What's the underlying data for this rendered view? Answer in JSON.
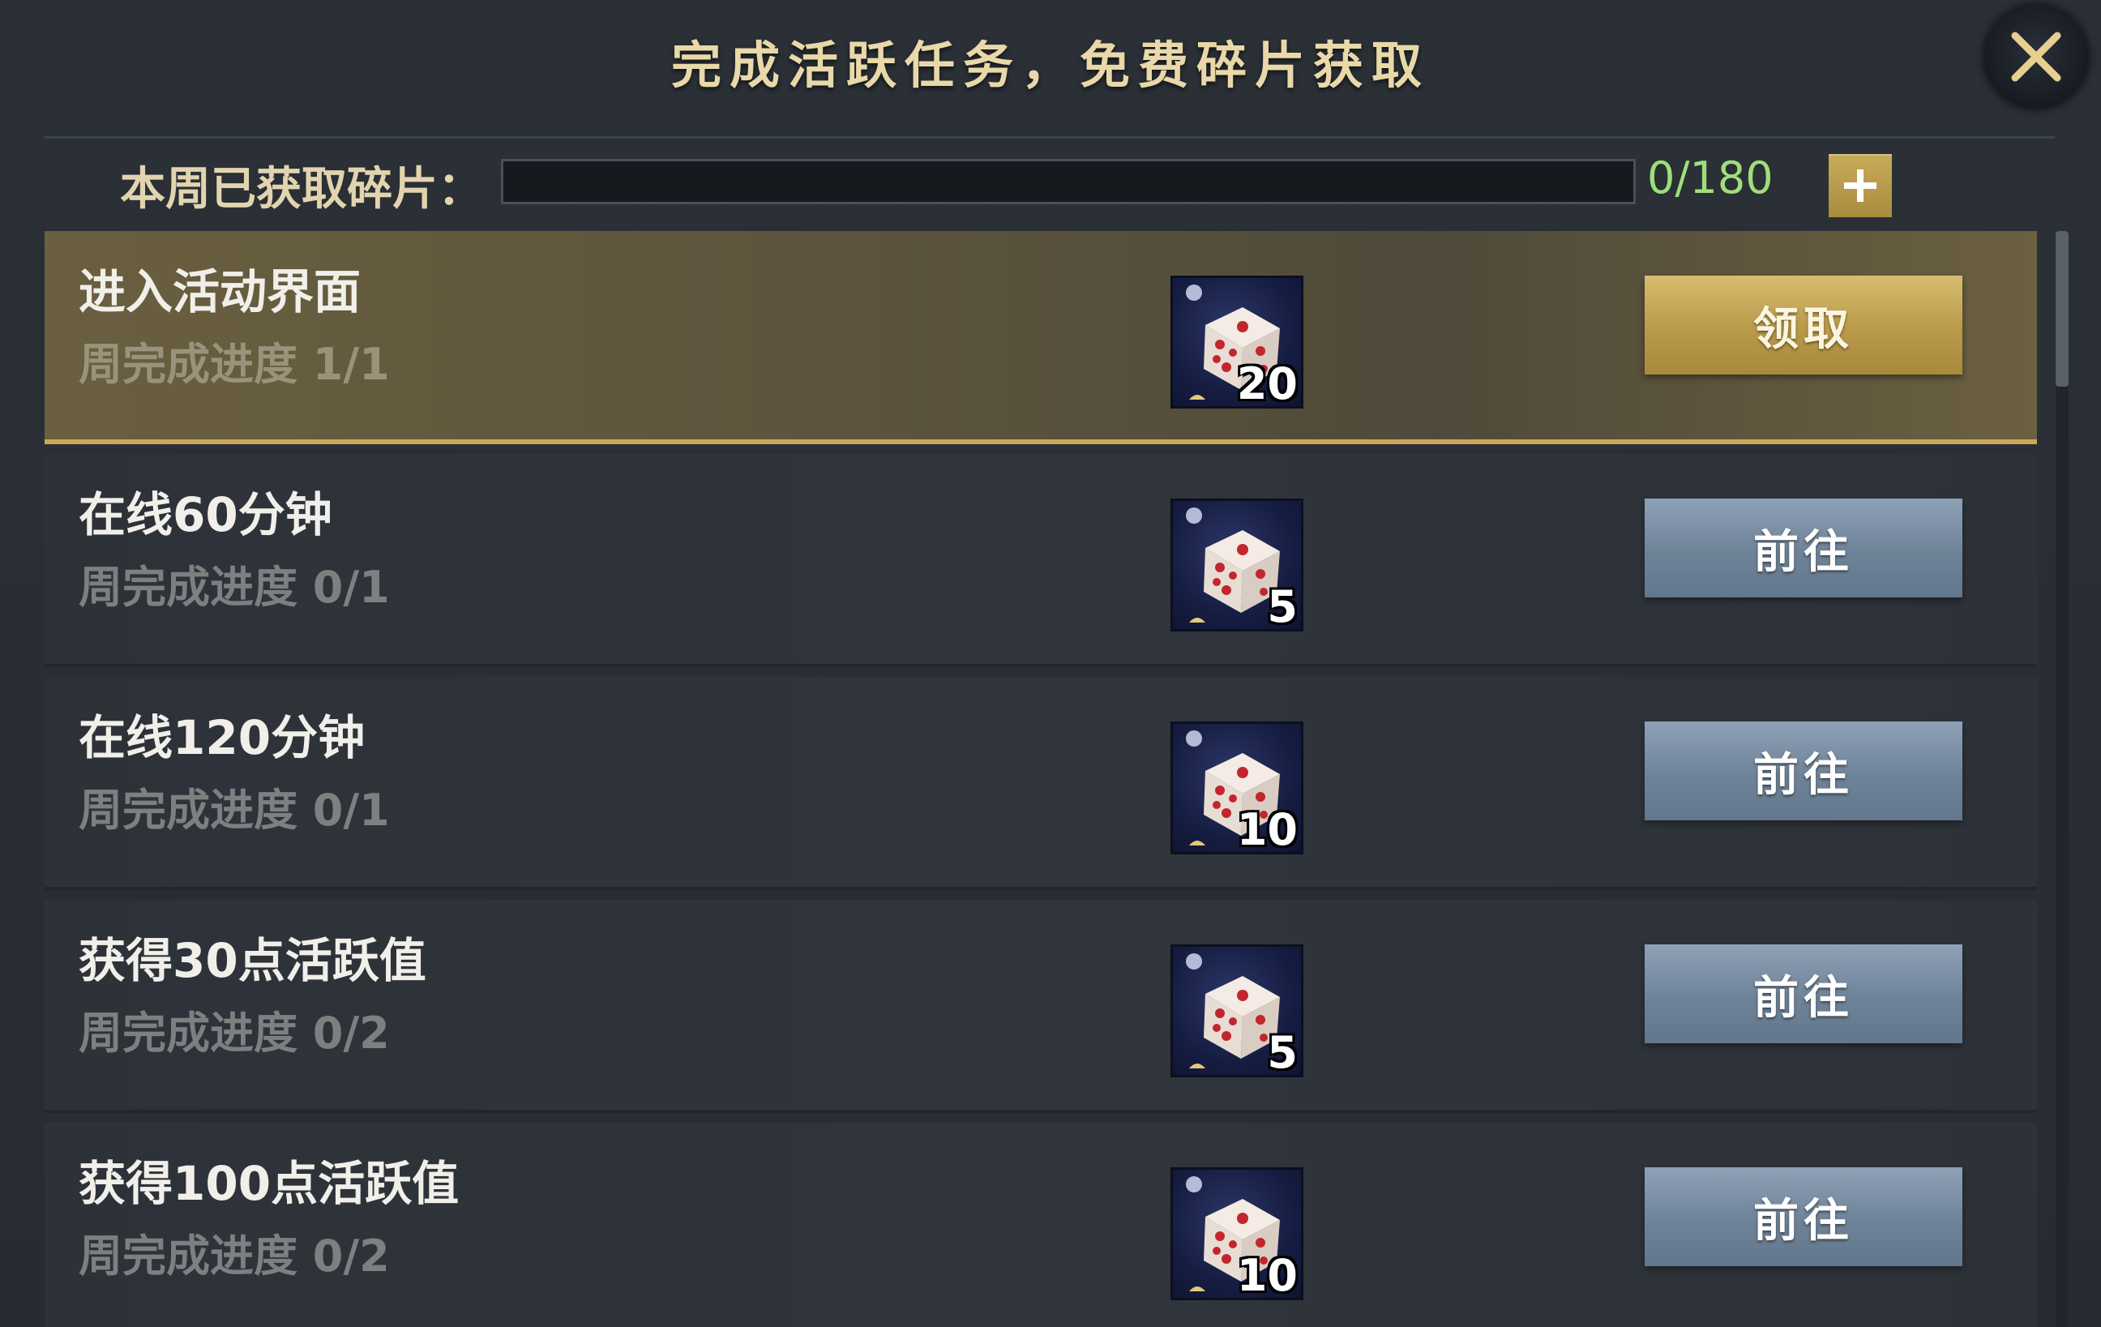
{
  "dialog": {
    "title": "完成活跃任务，免费碎片获取",
    "close_icon": "close-icon"
  },
  "weekly_progress": {
    "label": "本周已获取碎片：",
    "current": 0,
    "max": 180,
    "value_text": "0/180",
    "fill_fraction": 0.0,
    "plus_icon": "plus-icon"
  },
  "tasks": [
    {
      "name": "进入活动界面",
      "progress": "周完成进度 1/1",
      "reward_icon": "dice-fragment-icon",
      "reward_count": "20",
      "action": "领取",
      "state": "claimable"
    },
    {
      "name": "在线60分钟",
      "progress": "周完成进度 0/1",
      "reward_icon": "dice-fragment-icon",
      "reward_count": "5",
      "action": "前往",
      "state": "goto"
    },
    {
      "name": "在线120分钟",
      "progress": "周完成进度 0/1",
      "reward_icon": "dice-fragment-icon",
      "reward_count": "10",
      "action": "前往",
      "state": "goto"
    },
    {
      "name": "获得30点活跃值",
      "progress": "周完成进度 0/2",
      "reward_icon": "dice-fragment-icon",
      "reward_count": "5",
      "action": "前往",
      "state": "goto"
    },
    {
      "name": "获得100点活跃值",
      "progress": "周完成进度 0/2",
      "reward_icon": "dice-fragment-icon",
      "reward_count": "10",
      "action": "前往",
      "state": "goto"
    }
  ],
  "colors": {
    "title_gold": "#e9d8a8",
    "progress_green": "#9fdf7a",
    "claim_gold": "#c6a853",
    "goto_blue": "#7d90a6"
  }
}
